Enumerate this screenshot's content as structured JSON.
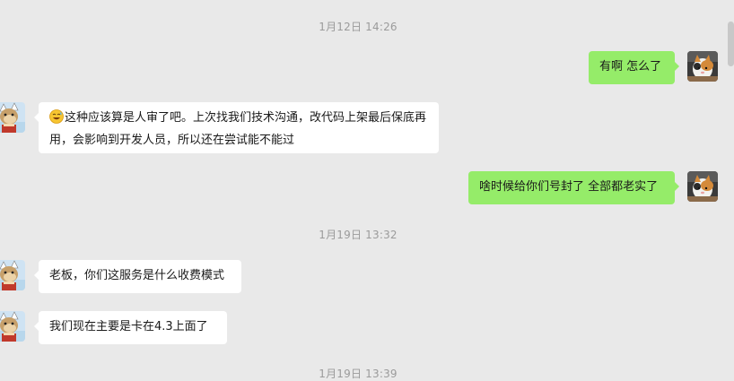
{
  "messages": [
    {
      "type": "timestamp",
      "text": "1月12日 14:26"
    },
    {
      "type": "out",
      "text": "有啊 怎么了",
      "avatar_icon": "cat-avatar-icon"
    },
    {
      "type": "in",
      "text": "这种应该算是人审了吧。上次找我们技术沟通，改代码上架最后保底再用，会影响到开发人员，所以还在尝试能不能过",
      "emoji": "sweat-smile-emoji",
      "avatar_icon": "cartoon-avatar-icon"
    },
    {
      "type": "out",
      "text": "啥时候给你们号封了 全部都老实了",
      "avatar_icon": "cat-avatar-icon"
    },
    {
      "type": "timestamp",
      "text": "1月19日 13:32"
    },
    {
      "type": "in",
      "text": "老板，你们这服务是什么收费模式",
      "avatar_icon": "cartoon-avatar-icon"
    },
    {
      "type": "in",
      "text": "我们现在主要是卡在4.3上面了",
      "avatar_icon": "cartoon-avatar-icon"
    },
    {
      "type": "timestamp",
      "text": "1月19日 13:39"
    }
  ],
  "colors": {
    "background": "#e9e9e9",
    "incoming_bubble": "#ffffff",
    "outgoing_bubble": "#95ec69",
    "timestamp_text": "#9b9b9b"
  }
}
